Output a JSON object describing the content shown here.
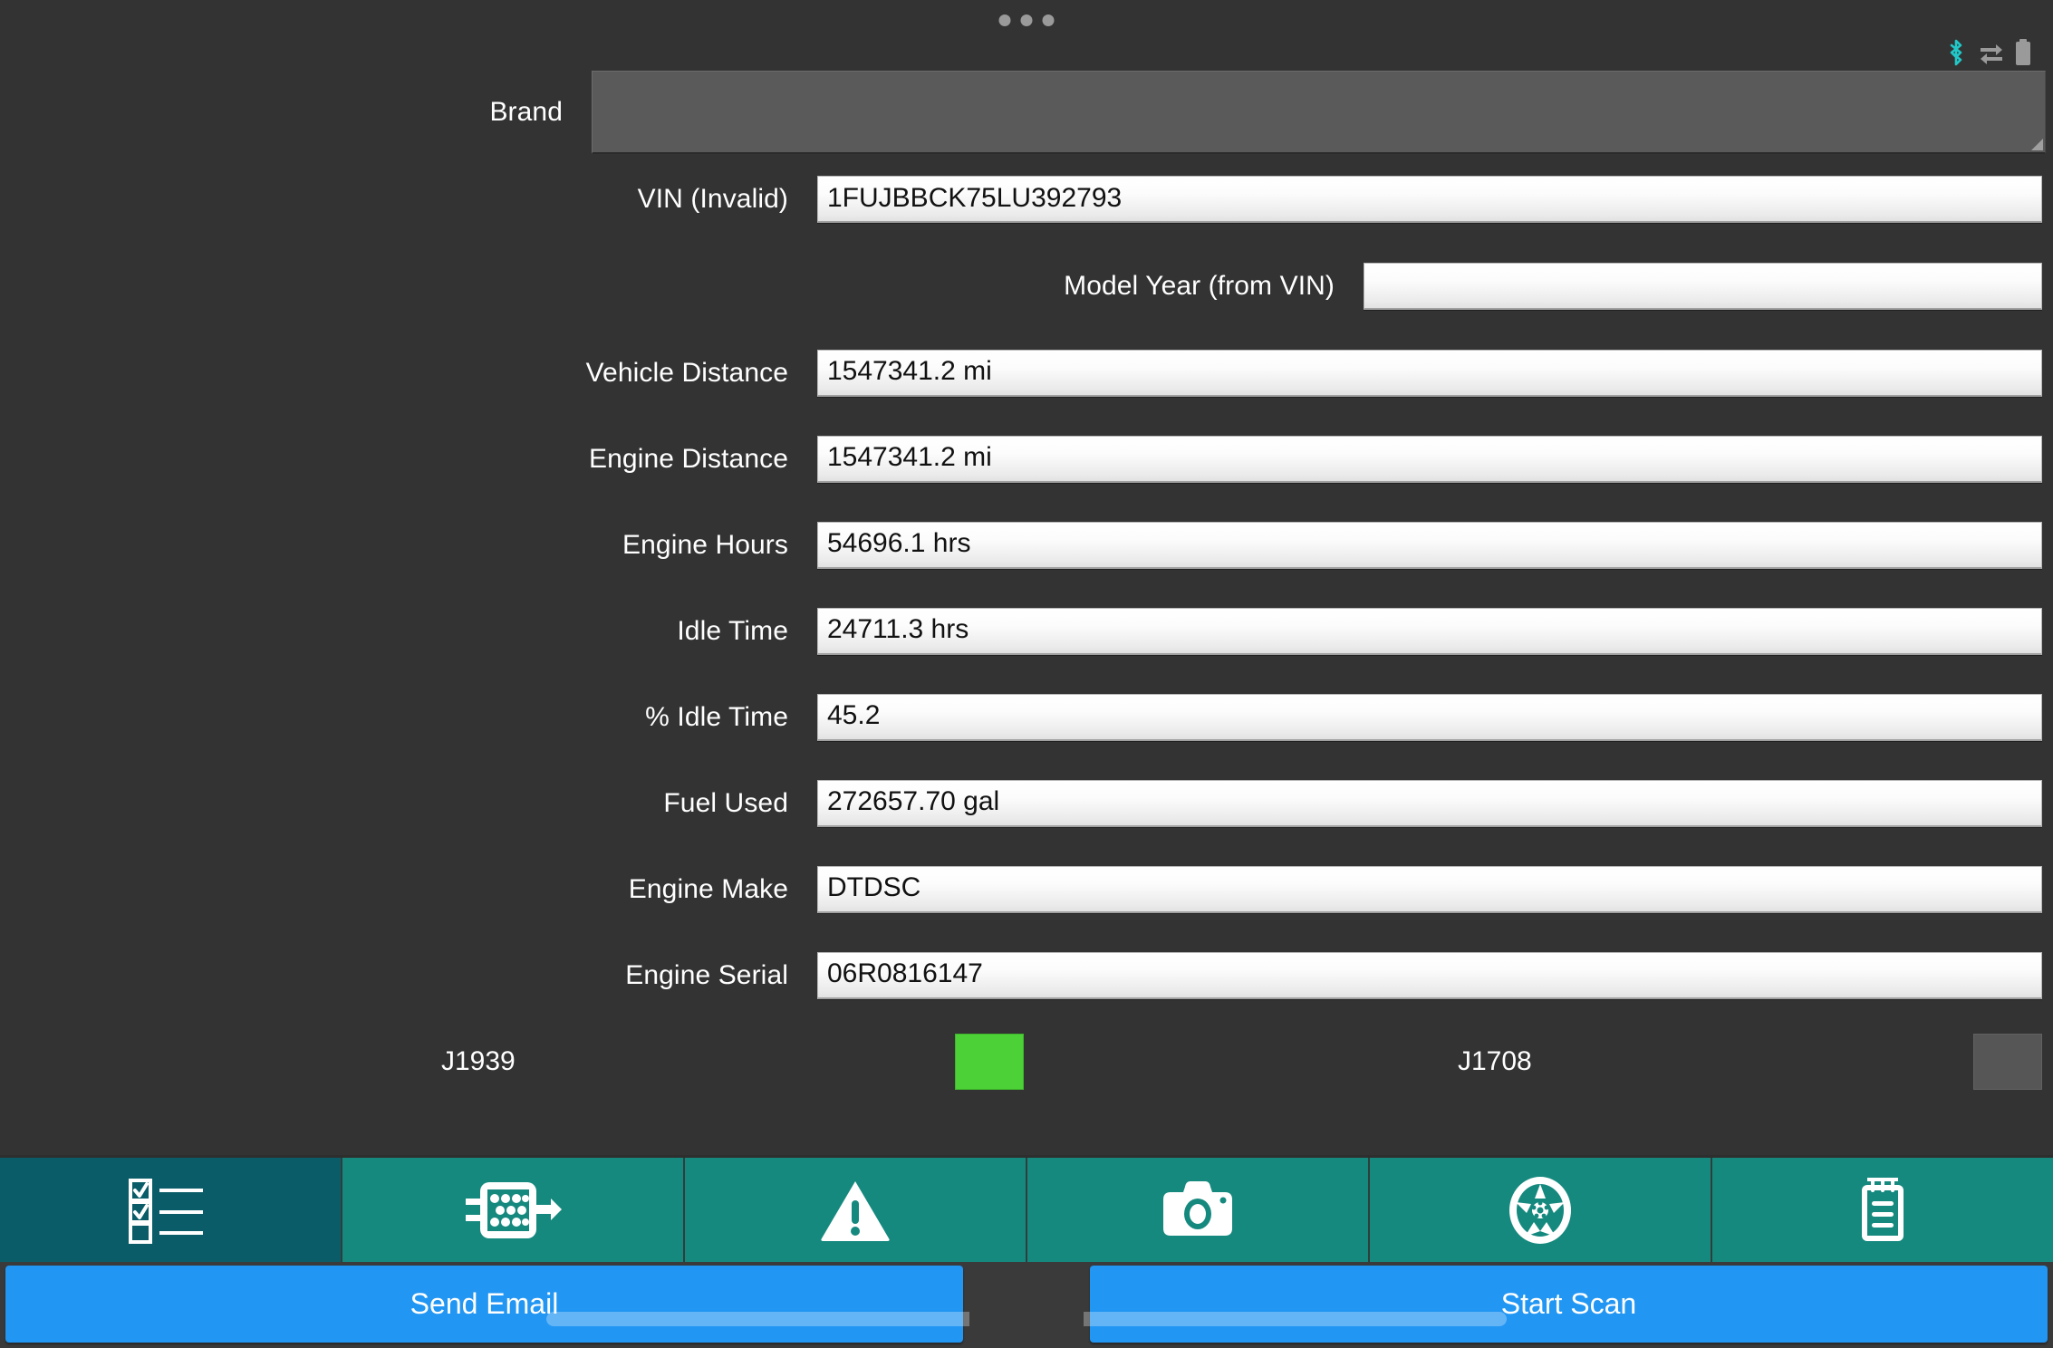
{
  "status_bar": {
    "handle_icon": "drag-handle-dots",
    "icons": [
      {
        "name": "bluetooth-icon",
        "color": "#22c7c7"
      },
      {
        "name": "data-transfer-icon",
        "color": "#9a9a9a"
      },
      {
        "name": "battery-icon",
        "color": "#9a9a9a"
      }
    ]
  },
  "form": {
    "rows": [
      {
        "label": "Brand",
        "value": "",
        "type": "spinner"
      },
      {
        "label": "VIN (Invalid)",
        "value": "1FUJBBCK75LU392793",
        "type": "text"
      },
      {
        "label": "Model Year (from VIN)",
        "value": "",
        "type": "text"
      },
      {
        "label": "Vehicle Distance",
        "value": "1547341.2 mi",
        "type": "text"
      },
      {
        "label": "Engine Distance",
        "value": "1547341.2 mi",
        "type": "text"
      },
      {
        "label": "Engine Hours",
        "value": "54696.1 hrs",
        "type": "text"
      },
      {
        "label": "Idle Time",
        "value": "24711.3 hrs",
        "type": "text"
      },
      {
        "label": "% Idle Time",
        "value": "45.2",
        "type": "text"
      },
      {
        "label": "Fuel Used",
        "value": "272657.70 gal",
        "type": "text"
      },
      {
        "label": "Engine Make",
        "value": "DTDSC",
        "type": "text"
      },
      {
        "label": "Engine Serial",
        "value": "06R0816147",
        "type": "text"
      }
    ],
    "protocols": {
      "j1939_label": "J1939",
      "j1939_status": "active",
      "j1939_color": "#4cd137",
      "j1708_label": "J1708",
      "j1708_status": "inactive",
      "j1708_color": "#565656"
    }
  },
  "tabbar": {
    "selected_index": 0,
    "tabs": [
      {
        "name": "checklist-icon",
        "label": "Checklist"
      },
      {
        "name": "connector-icon",
        "label": "Connector"
      },
      {
        "name": "warning-triangle-icon",
        "label": "Faults"
      },
      {
        "name": "camera-icon",
        "label": "Camera"
      },
      {
        "name": "wheel-icon",
        "label": "Wheels"
      },
      {
        "name": "notepad-icon",
        "label": "Notes"
      }
    ]
  },
  "actionbar": {
    "send_email_label": "Send Email",
    "home_icon": "home-icon",
    "start_scan_label": "Start Scan",
    "accent_color": "#2196f3"
  }
}
